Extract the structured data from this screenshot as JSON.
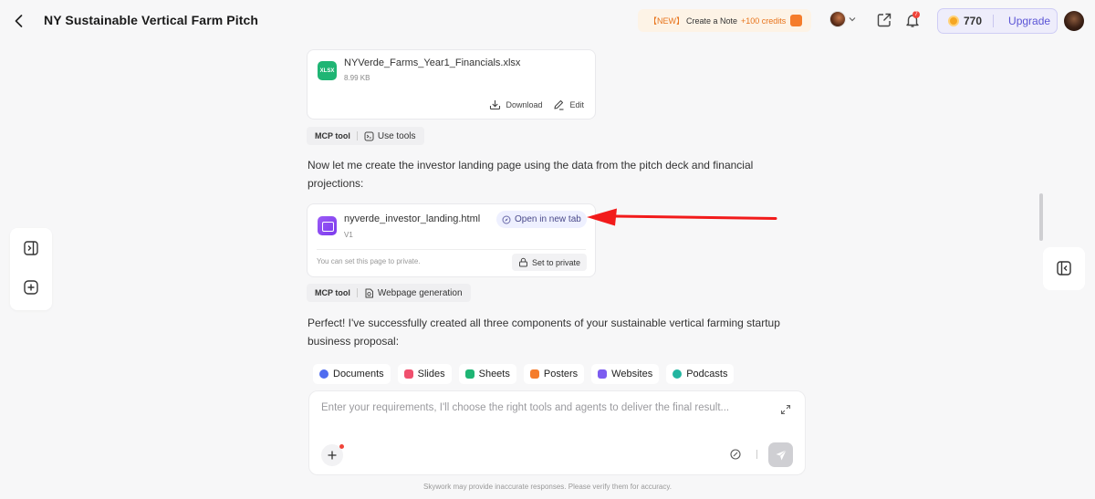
{
  "header": {
    "title": "NY Sustainable Vertical Farm Pitch",
    "promo_tag": "【NEW】",
    "promo_text": "Create a Note",
    "promo_credits": "+100 credits",
    "credits": "770",
    "upgrade_label": "Upgrade",
    "notification_count": "7"
  },
  "file_card": {
    "icon_label": "XLSX",
    "name": "NYVerde_Farms_Year1_Financials.xlsx",
    "size": "8.99 KB",
    "download_label": "Download",
    "edit_label": "Edit"
  },
  "tool_chip_1": {
    "mcp_label": "MCP tool",
    "tool_label": "Use tools"
  },
  "message_1": "Now let me create the investor landing page using the data from the pitch deck and financial projections:",
  "web_card": {
    "name": "nyverde_investor_landing.html",
    "version": "V1",
    "open_tab_label": "Open in new tab",
    "private_note": "You can set this page to private.",
    "set_private_label": "Set to private"
  },
  "tool_chip_2": {
    "mcp_label": "MCP tool",
    "tool_label": "Webpage generation"
  },
  "message_2": "Perfect! I've successfully created all three components of your sustainable vertical farming startup business proposal:",
  "tools": [
    {
      "label": "Documents",
      "color": "#4f6cf0"
    },
    {
      "label": "Slides",
      "color": "#f0506e"
    },
    {
      "label": "Sheets",
      "color": "#1fb574"
    },
    {
      "label": "Posters",
      "color": "#f57c2b"
    },
    {
      "label": "Websites",
      "color": "#7c5cf0"
    },
    {
      "label": "Podcasts",
      "color": "#22b5a0"
    }
  ],
  "input": {
    "placeholder": "Enter your requirements, I'll choose the right tools and agents to deliver the final result..."
  },
  "disclaimer": "Skywork may provide inaccurate responses. Please verify them for accuracy."
}
